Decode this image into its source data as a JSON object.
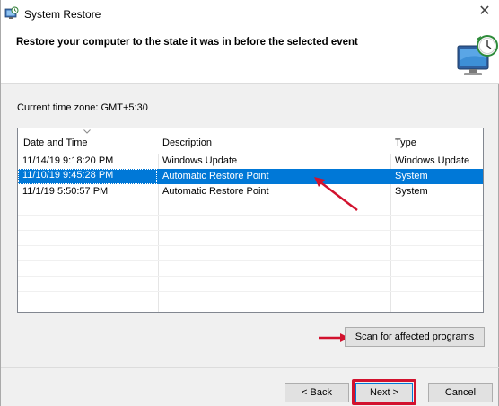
{
  "window": {
    "title": "System Restore",
    "close_glyph": "✕",
    "icon": "system-restore-icon"
  },
  "header": {
    "text": "Restore your computer to the state it was in before the selected event",
    "graphic": "system-restore-graphic"
  },
  "timezone": {
    "label": "Current time zone: GMT+5:30"
  },
  "table": {
    "columns": [
      "Date and Time",
      "Description",
      "Type"
    ],
    "sort_column": "Date and Time",
    "rows": [
      {
        "date": "11/14/19 9:18:20 PM",
        "description": "Windows Update",
        "type": "Windows Update",
        "selected": false
      },
      {
        "date": "11/10/19 9:45:28 PM",
        "description": "Automatic Restore Point",
        "type": "System",
        "selected": true
      },
      {
        "date": "11/1/19 5:50:57 PM",
        "description": "Automatic Restore Point",
        "type": "System",
        "selected": false
      }
    ]
  },
  "buttons": {
    "scan": "Scan for affected programs",
    "back": "< Back",
    "next": "Next >",
    "cancel": "Cancel"
  },
  "colors": {
    "selection": "#0078d7",
    "annotation": "#d2122e"
  }
}
